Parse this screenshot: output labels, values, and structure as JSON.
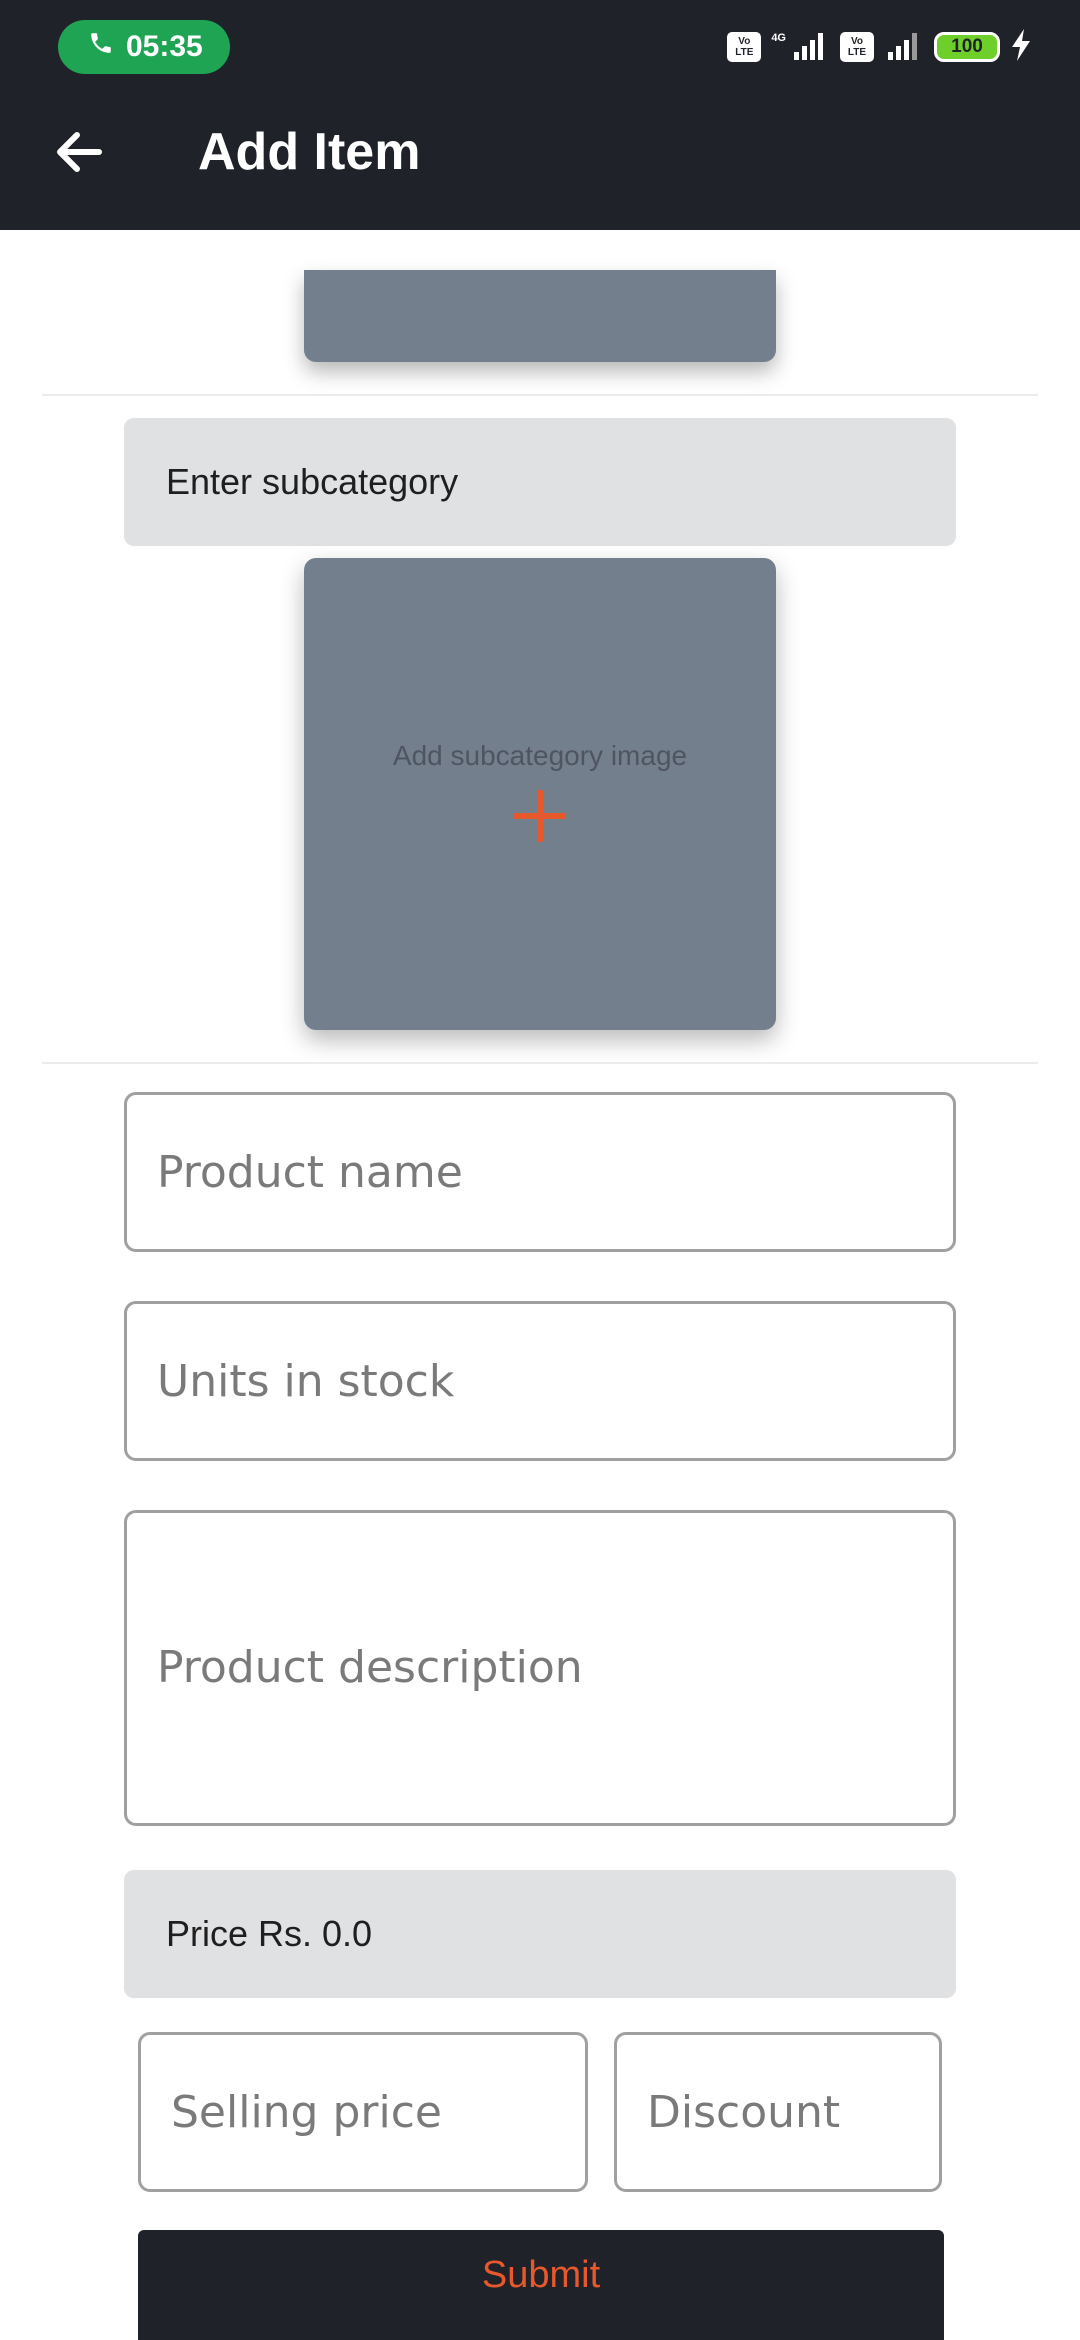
{
  "status_bar": {
    "time": "05:35",
    "network_label": "4G",
    "volte_label": "Vo LTE",
    "battery_level": "100"
  },
  "header": {
    "title": "Add Item"
  },
  "form": {
    "subcategory_field": "Enter subcategory",
    "subcategory_image_label": "Add subcategory image",
    "product_name_placeholder": "Product name",
    "units_in_stock_placeholder": "Units in stock",
    "product_description_placeholder": "Product description",
    "price_display": "Price Rs. 0.0",
    "selling_price_placeholder": "Selling price",
    "discount_placeholder": "Discount",
    "submit_label": "Submit"
  },
  "colors": {
    "app_bar": "#1f2228",
    "accent": "#e7592d",
    "call_pill": "#1fa453",
    "image_card": "#747f8d"
  },
  "icons": {
    "back": "arrow-left-icon",
    "add_image": "plus-icon",
    "call": "phone-icon",
    "charging": "bolt-icon"
  }
}
